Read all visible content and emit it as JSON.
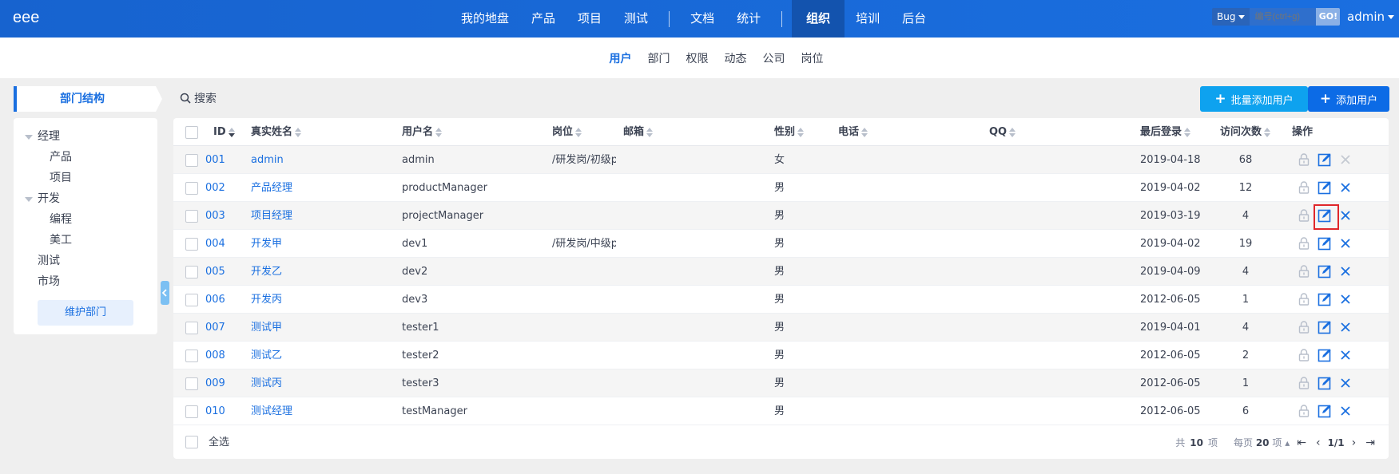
{
  "header": {
    "brand": "eee",
    "nav": [
      "我的地盘",
      "产品",
      "项目",
      "测试",
      "文档",
      "统计",
      "组织",
      "培训",
      "后台"
    ],
    "active_nav": "组织",
    "search_type": "Bug",
    "search_placeholder": "编号(ctrl+g)",
    "go_label": "GO!",
    "user": "admin"
  },
  "subnav": {
    "items": [
      "用户",
      "部门",
      "权限",
      "动态",
      "公司",
      "岗位"
    ],
    "active": "用户"
  },
  "sidebar": {
    "tab_label": "部门结构",
    "tree": [
      {
        "label": "经理",
        "level": 0,
        "expanded": true
      },
      {
        "label": "产品",
        "level": 1
      },
      {
        "label": "项目",
        "level": 1
      },
      {
        "label": "开发",
        "level": 0,
        "expanded": true
      },
      {
        "label": "编程",
        "level": 1
      },
      {
        "label": "美工",
        "level": 1
      },
      {
        "label": "测试",
        "level": 0
      },
      {
        "label": "市场",
        "level": 0
      }
    ],
    "maintain_label": "维护部门"
  },
  "toolbar": {
    "search_label": "搜索",
    "batch_add_label": "批量添加用户",
    "add_label": "添加用户"
  },
  "table": {
    "columns": [
      "ID",
      "真实姓名",
      "用户名",
      "岗位",
      "邮箱",
      "性别",
      "电话",
      "QQ",
      "最后登录",
      "访问次数",
      "操作"
    ],
    "rows": [
      {
        "id": "001",
        "realname": "admin",
        "account": "admin",
        "role": "/研发岗/初级pl",
        "email": "",
        "gender": "女",
        "phone": "",
        "qq": "",
        "last": "2019-04-18",
        "visits": "68"
      },
      {
        "id": "002",
        "realname": "产品经理",
        "account": "productManager",
        "role": "",
        "email": "",
        "gender": "男",
        "phone": "",
        "qq": "",
        "last": "2019-04-02",
        "visits": "12"
      },
      {
        "id": "003",
        "realname": "项目经理",
        "account": "projectManager",
        "role": "",
        "email": "",
        "gender": "男",
        "phone": "",
        "qq": "",
        "last": "2019-03-19",
        "visits": "4"
      },
      {
        "id": "004",
        "realname": "开发甲",
        "account": "dev1",
        "role": "/研发岗/中级pl",
        "email": "",
        "gender": "男",
        "phone": "",
        "qq": "",
        "last": "2019-04-02",
        "visits": "19"
      },
      {
        "id": "005",
        "realname": "开发乙",
        "account": "dev2",
        "role": "",
        "email": "",
        "gender": "男",
        "phone": "",
        "qq": "",
        "last": "2019-04-09",
        "visits": "4"
      },
      {
        "id": "006",
        "realname": "开发丙",
        "account": "dev3",
        "role": "",
        "email": "",
        "gender": "男",
        "phone": "",
        "qq": "",
        "last": "2012-06-05",
        "visits": "1"
      },
      {
        "id": "007",
        "realname": "测试甲",
        "account": "tester1",
        "role": "",
        "email": "",
        "gender": "男",
        "phone": "",
        "qq": "",
        "last": "2019-04-01",
        "visits": "4"
      },
      {
        "id": "008",
        "realname": "测试乙",
        "account": "tester2",
        "role": "",
        "email": "",
        "gender": "男",
        "phone": "",
        "qq": "",
        "last": "2012-06-05",
        "visits": "2"
      },
      {
        "id": "009",
        "realname": "测试丙",
        "account": "tester3",
        "role": "",
        "email": "",
        "gender": "男",
        "phone": "",
        "qq": "",
        "last": "2012-06-05",
        "visits": "1"
      },
      {
        "id": "010",
        "realname": "测试经理",
        "account": "testManager",
        "role": "",
        "email": "",
        "gender": "男",
        "phone": "",
        "qq": "",
        "last": "2012-06-05",
        "visits": "6"
      }
    ],
    "row_actions": [
      "lock-icon",
      "edit-icon",
      "delete-icon"
    ]
  },
  "footer": {
    "select_all": "全选",
    "total_prefix": "共",
    "total": "10",
    "total_suffix": "项",
    "per_page_prefix": "每页",
    "per_page": "20",
    "per_page_suffix": "项",
    "page": "1/1"
  },
  "colors": {
    "topbar": "#1a6fe0",
    "active_nav": "#1353ae",
    "link": "#1a6fe0",
    "batch_button": "#0ea2ef",
    "add_button": "#0c6be6",
    "highlight_box": "#e0272b"
  }
}
